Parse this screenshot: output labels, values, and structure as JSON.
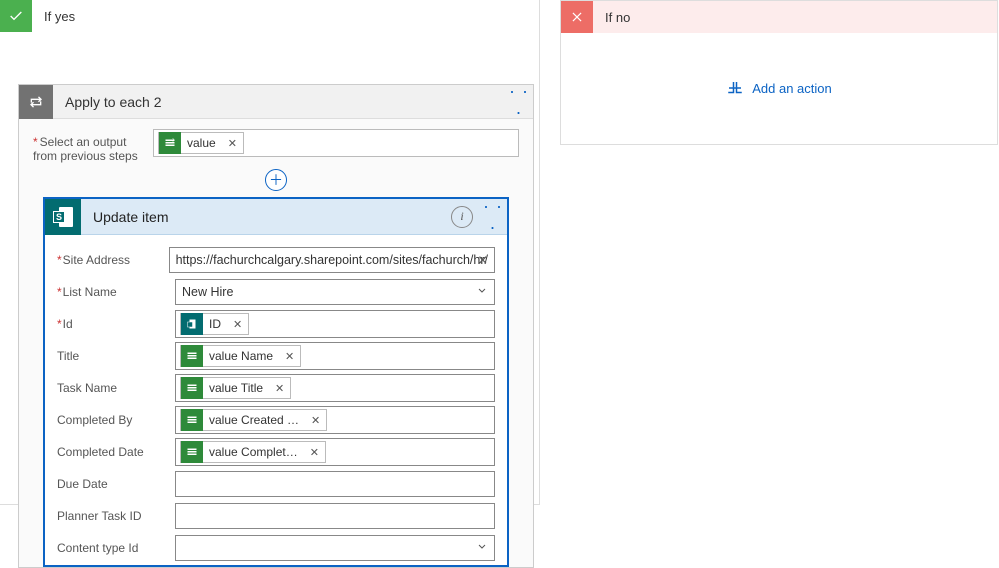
{
  "branch_yes": {
    "title": "If yes"
  },
  "branch_no": {
    "title": "If no",
    "add_action": "Add an action"
  },
  "foreach": {
    "title": "Apply to each 2",
    "select_label": "Select an output from previous steps",
    "value_token": "value"
  },
  "update": {
    "title": "Update item",
    "fields": {
      "site_address": {
        "label": "Site Address",
        "value": "https://fachurchcalgary.sharepoint.com/sites/fachurch/hr/"
      },
      "list_name": {
        "label": "List Name",
        "value": "New Hire"
      },
      "id": {
        "label": "Id",
        "token": "ID"
      },
      "title": {
        "label": "Title",
        "token": "value Name"
      },
      "task_name": {
        "label": "Task Name",
        "token": "value Title"
      },
      "completed_by": {
        "label": "Completed By",
        "token": "value Created …"
      },
      "completed_date": {
        "label": "Completed Date",
        "token": "value Complet…"
      },
      "due_date": {
        "label": "Due Date"
      },
      "planner_task": {
        "label": "Planner Task ID"
      },
      "content_type": {
        "label": "Content type Id"
      }
    }
  }
}
